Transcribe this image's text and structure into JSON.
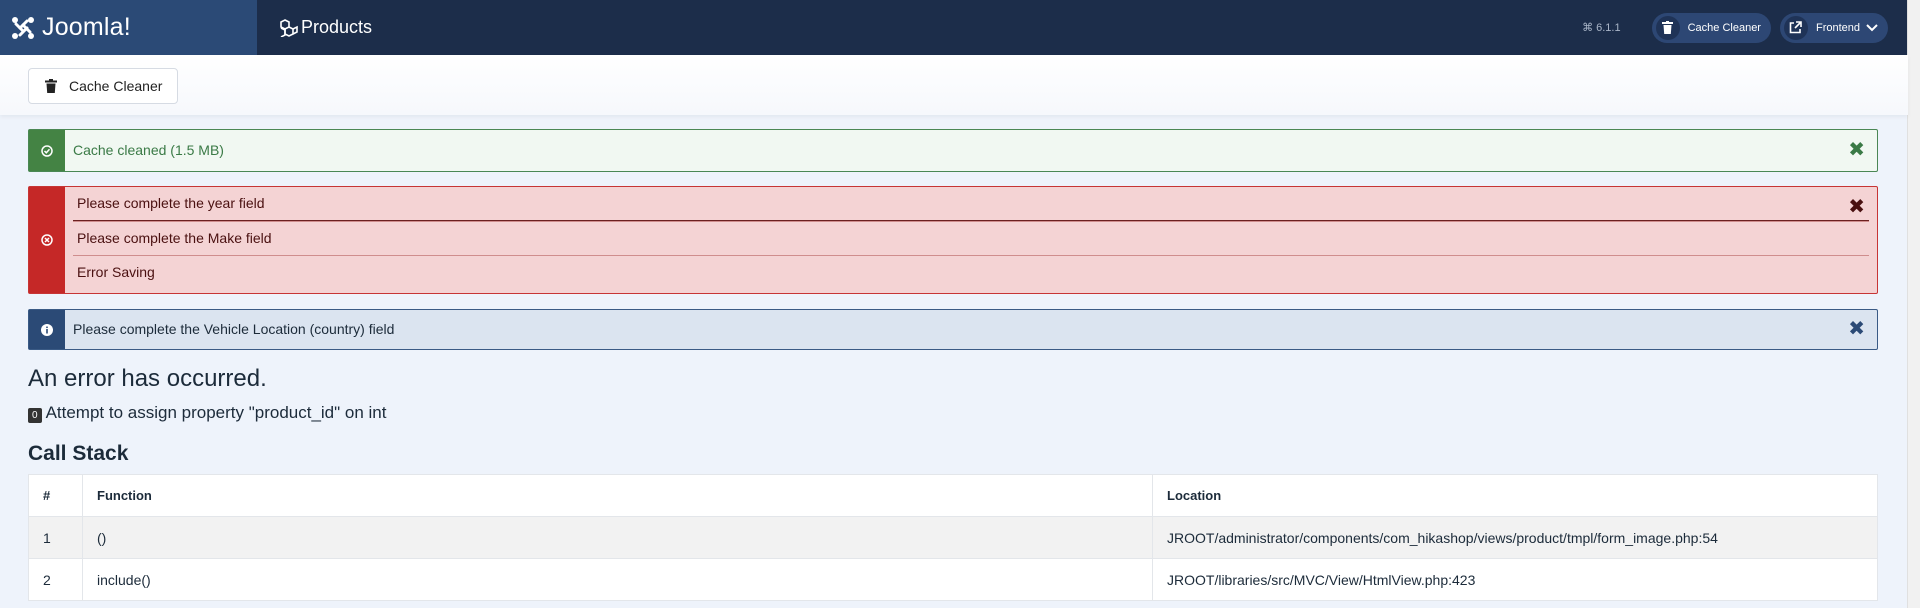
{
  "header": {
    "logo_text": "Joomla!",
    "page_title": "Products",
    "version": "6.1.1",
    "cache_cleaner_label": "Cache Cleaner",
    "frontend_label": "Frontend"
  },
  "toolbar": {
    "cache_cleaner_label": "Cache Cleaner"
  },
  "alerts": {
    "success": "Cache cleaned (1.5 MB)",
    "errors": [
      "Please complete the year field",
      "Please complete the Make field",
      "Error Saving"
    ],
    "info": "Please complete the Vehicle Location (country) field",
    "close_glyph": "✖"
  },
  "error": {
    "title": "An error has occurred.",
    "code": "0",
    "message": "Attempt to assign property \"product_id\" on int"
  },
  "call_stack": {
    "title": "Call Stack",
    "headers": [
      "#",
      "Function",
      "Location"
    ],
    "rows": [
      {
        "num": "1",
        "function": "()",
        "location": "JROOT/administrator/components/com_hikashop/views/product/tmpl/form_image.php:54"
      },
      {
        "num": "2",
        "function": "include()",
        "location": "JROOT/libraries/src/MVC/View/HtmlView.php:423"
      }
    ]
  },
  "colors": {
    "header_bg": "#1c2d4a",
    "logo_bg": "#2b4a76",
    "success": "#448344",
    "error": "#c52827",
    "info": "#2b4a76"
  }
}
